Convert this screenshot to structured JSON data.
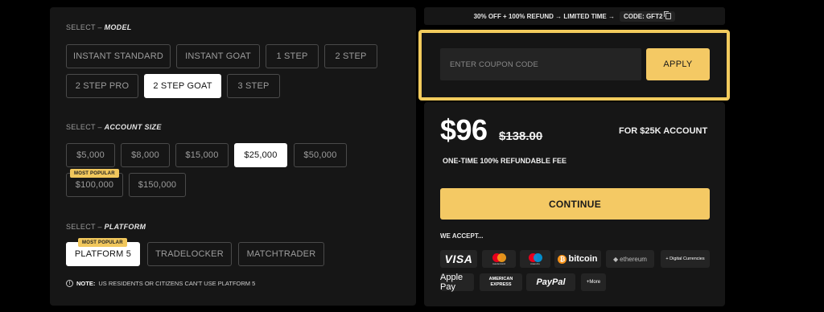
{
  "model": {
    "label_prefix": "SELECT – ",
    "label_bold": "MODEL",
    "options": [
      "INSTANT STANDARD",
      "INSTANT GOAT",
      "1 STEP",
      "2 STEP",
      "2 STEP PRO",
      "2 STEP GOAT",
      "3 STEP"
    ],
    "selected": "2 STEP GOAT"
  },
  "account_size": {
    "label_prefix": "SELECT – ",
    "label_bold": "ACCOUNT SIZE",
    "options": [
      "$5,000",
      "$8,000",
      "$15,000",
      "$25,000",
      "$50,000",
      "$100,000",
      "$150,000"
    ],
    "selected": "$25,000",
    "badge": "MOST POPULAR"
  },
  "platform": {
    "label_prefix": "SELECT – ",
    "label_bold": "PLATFORM",
    "options": [
      "PLATFORM 5",
      "TRADELOCKER",
      "MATCHTRADER"
    ],
    "selected": "PLATFORM 5",
    "badge": "MOST POPULAR"
  },
  "note": {
    "icon": "info-icon",
    "bold": "NOTE:",
    "text": "US RESIDENTS OR CITIZENS CAN'T USE PLATFORM 5"
  },
  "promo": {
    "text": "30% OFF + 100% REFUND → LIMITED TIME →",
    "code": "CODE: GFT2",
    "icon": "copy-icon"
  },
  "coupon": {
    "placeholder": "ENTER COUPON CODE",
    "value": "",
    "apply_label": "APPLY",
    "highlight_color": "#f2cb5d"
  },
  "pricing": {
    "price": "$96",
    "old_price": "$138.00",
    "account_label": "FOR $25K ACCOUNT",
    "fee_label": "ONE-TIME 100% REFUNDABLE FEE",
    "continue_label": "CONTINUE",
    "accent_color": "#f4c964"
  },
  "payments": {
    "label": "WE ACCEPT...",
    "methods": [
      "VISA",
      "mastercard",
      "maestro",
      "bitcoin",
      "ethereum",
      "+ Digital Currencies",
      "Apple Pay",
      "AMERICAN EXPRESS",
      "PayPal",
      "+More"
    ]
  }
}
